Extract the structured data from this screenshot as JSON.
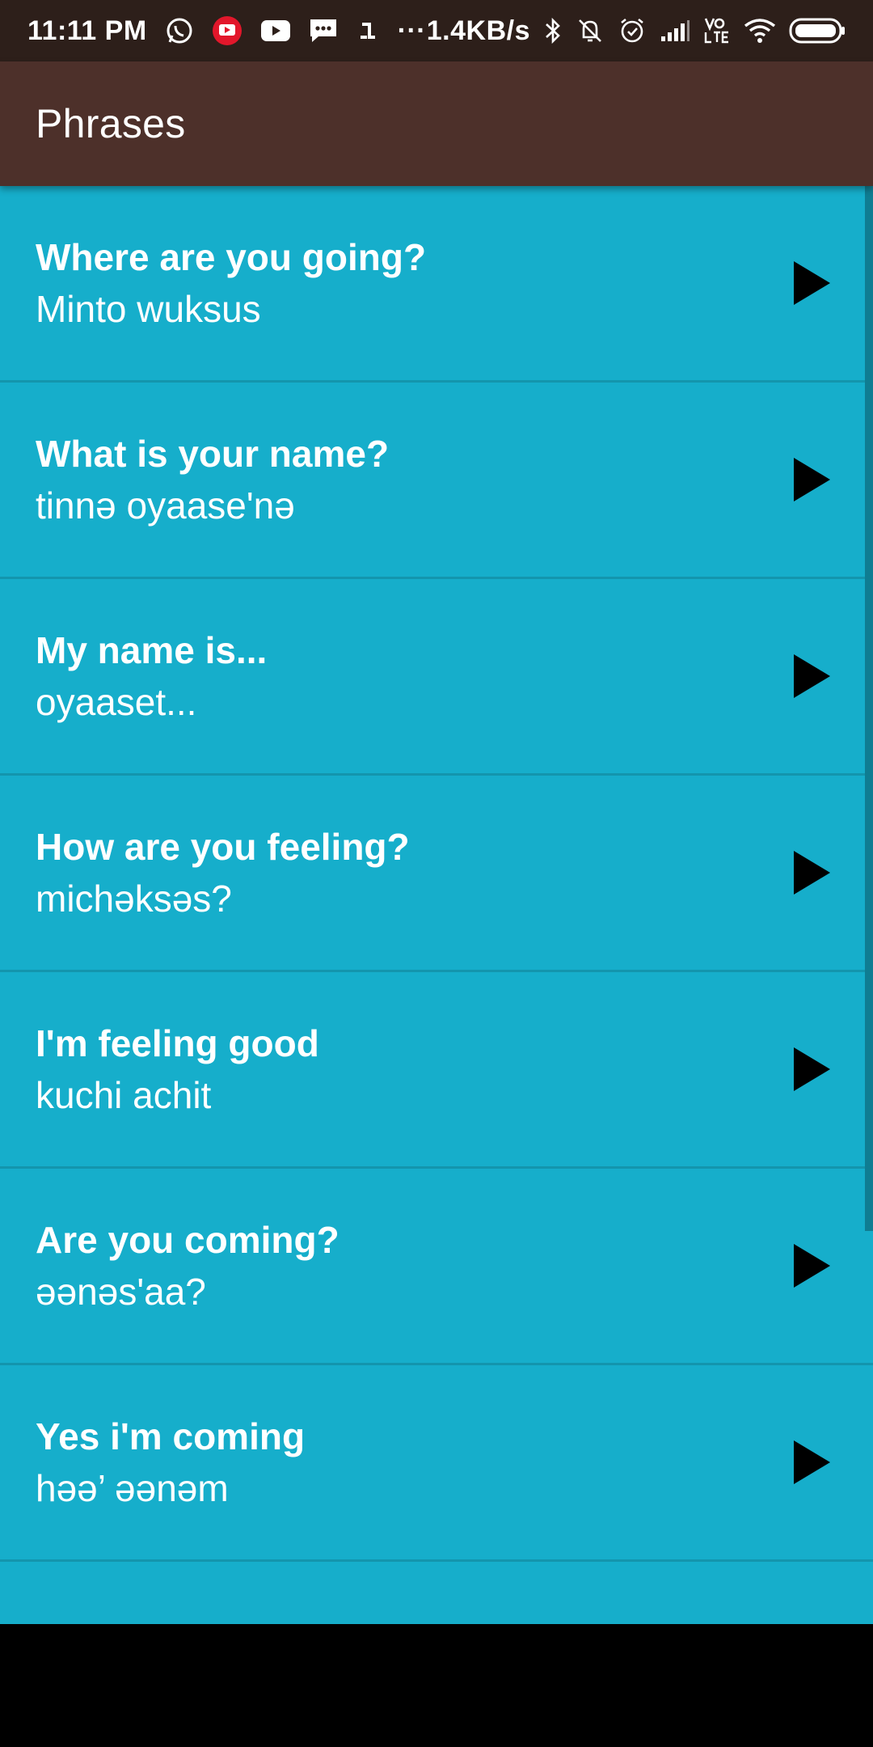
{
  "status_bar": {
    "time": "11:11 PM",
    "network_speed": "1.4KB/s",
    "more_indicator": "···",
    "left_icons": [
      "whatsapp-icon",
      "youtube-red-icon",
      "youtube-icon",
      "message-icon",
      "notification-1-icon"
    ],
    "right_icons": [
      "bluetooth-icon",
      "mute-vibrate-icon",
      "alarm-icon",
      "signal-icon",
      "volte-icon",
      "wifi-icon",
      "battery-icon"
    ]
  },
  "app_bar": {
    "title": "Phrases"
  },
  "colors": {
    "status_bar": "#2d1f1a",
    "app_bar": "#4d302a",
    "list_background": "#16aecb",
    "divider": "#1395ad",
    "text": "#ffffff",
    "play_icon": "#000000"
  },
  "phrases": [
    {
      "english": "Where are you going?",
      "translation": "Minto wuksus"
    },
    {
      "english": "What is your name?",
      "translation": "tinnə oyaase'nə"
    },
    {
      "english": "My name is...",
      "translation": "oyaaset..."
    },
    {
      "english": "How are you feeling?",
      "translation": "michəksəs?"
    },
    {
      "english": "I'm feeling good",
      "translation": "kuchi achit"
    },
    {
      "english": "Are you coming?",
      "translation": "əənəs'aa?"
    },
    {
      "english": "Yes i'm coming",
      "translation": "həə’ əənəm"
    },
    {
      "english": "",
      "translation": ""
    }
  ]
}
